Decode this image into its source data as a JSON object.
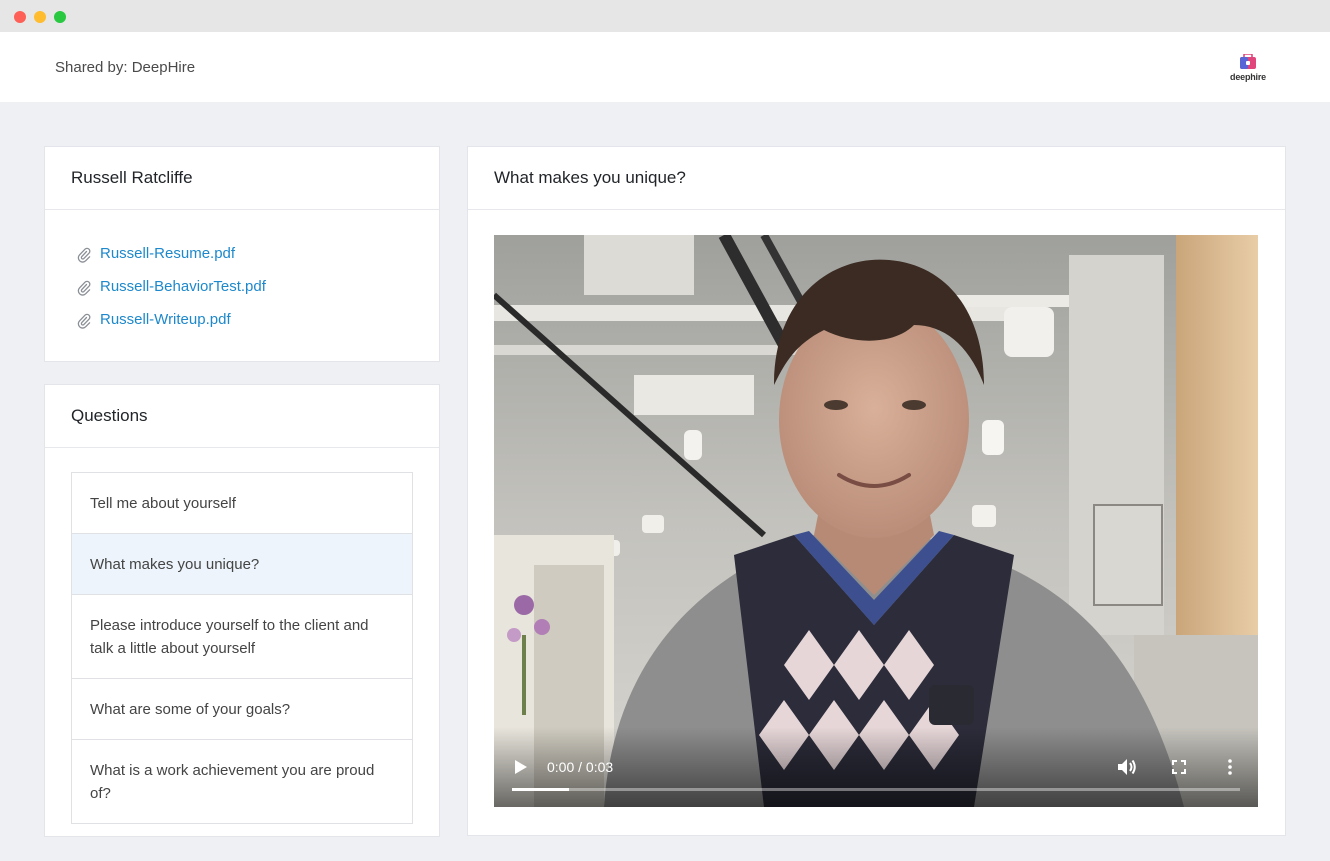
{
  "header": {
    "shared_by": "Shared by: DeepHire",
    "logo_text": "deephire"
  },
  "candidate": {
    "name": "Russell Ratcliffe",
    "files": [
      {
        "label": "Russell-Resume.pdf"
      },
      {
        "label": "Russell-BehaviorTest.pdf"
      },
      {
        "label": "Russell-Writeup.pdf"
      }
    ]
  },
  "questions": {
    "title": "Questions",
    "items": [
      {
        "label": "Tell me about yourself",
        "active": false
      },
      {
        "label": "What makes you unique?",
        "active": true
      },
      {
        "label": "Please introduce yourself to the client and talk a little about yourself",
        "active": false
      },
      {
        "label": "What are some of your goals?",
        "active": false
      },
      {
        "label": "What is a work achievement you are proud of?",
        "active": false
      }
    ]
  },
  "video_panel": {
    "title": "What makes you unique?",
    "player": {
      "time": "0:00 / 0:03",
      "progress": 0.078,
      "icons": [
        "play-icon",
        "volume-icon",
        "fullscreen-icon",
        "more-icon"
      ]
    }
  },
  "colors": {
    "link": "#1d88cc",
    "active_question_bg": "#edf4fb",
    "page_bg": "#eff0f4"
  }
}
